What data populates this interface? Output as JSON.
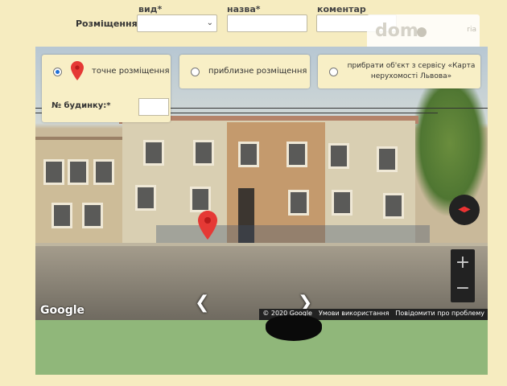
{
  "form": {
    "placement_label": "Розміщення:",
    "type_label": "вид*",
    "name_label": "назва*",
    "comment_label": "коментар",
    "type_value": "",
    "name_value": "",
    "comment_value": ""
  },
  "options": {
    "exact": {
      "label": "точне розміщення",
      "selected": true
    },
    "approx": {
      "label": "приблизне розміщення",
      "selected": false
    },
    "remove": {
      "label": "прибрати об'єкт з сервісу «Карта нерухомості Львова»",
      "selected": false
    },
    "house_number_label": "№ будинку:*",
    "house_number_value": ""
  },
  "map": {
    "provider_logo": "Google",
    "copyright": "© 2020 Google",
    "terms": "Умови використання",
    "report": "Повідомити про проблему",
    "zoom_in": "+",
    "zoom_out": "−",
    "nav_left": "❮",
    "nav_right": "❯"
  },
  "icons": {
    "pin": "map-pin-icon",
    "compass": "compass-icon"
  },
  "colors": {
    "background": "#f6ecc0",
    "pin": "#e53935",
    "radio_selected": "#1f6fd6"
  }
}
